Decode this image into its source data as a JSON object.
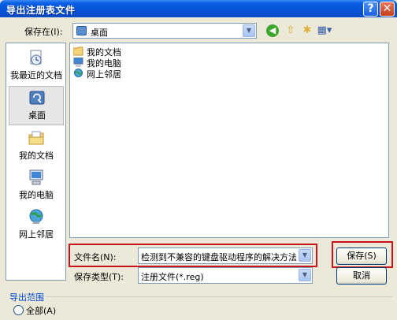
{
  "window": {
    "title": "导出注册表文件",
    "help_glyph": "?",
    "close_glyph": "✕"
  },
  "save_in": {
    "label": "保存在(I):",
    "value": "桌面",
    "icon": "desktop-icon"
  },
  "toolbar": {
    "back_glyph": "◀",
    "up_glyph": "⇧",
    "new_folder_glyph": "✱",
    "views_glyph": "▦▾"
  },
  "places": [
    {
      "label": "我最近的文档",
      "icon": "recent-documents-icon"
    },
    {
      "label": "桌面",
      "icon": "desktop-icon"
    },
    {
      "label": "我的文档",
      "icon": "my-documents-icon"
    },
    {
      "label": "我的电脑",
      "icon": "my-computer-icon"
    },
    {
      "label": "网上邻居",
      "icon": "network-places-icon"
    }
  ],
  "files": [
    {
      "label": "我的文档",
      "icon": "folder-icon"
    },
    {
      "label": "我的电脑",
      "icon": "computer-icon"
    },
    {
      "label": "网上邻居",
      "icon": "network-icon"
    }
  ],
  "filename": {
    "label": "文件名(N):",
    "value": "检测到不兼容的键盘驱动程序的解决方法"
  },
  "filetype": {
    "label": "保存类型(T):",
    "value": "注册文件(*.reg)"
  },
  "buttons": {
    "save": "保存(S)",
    "cancel": "取消"
  },
  "export_range": {
    "label": "导出范围",
    "option_all": "全部(A)"
  },
  "colors": {
    "title_bar": "#0a5fe3",
    "highlight_box": "#c8131b",
    "dialog_bg": "#ece9d8"
  }
}
